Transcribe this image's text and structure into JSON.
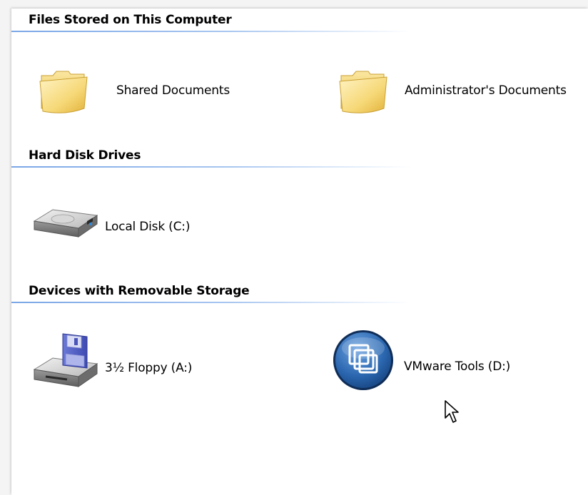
{
  "groups": [
    {
      "header": "Files Stored on This Computer",
      "items": [
        {
          "label": "Shared Documents",
          "icon": "folder-icon"
        },
        {
          "label": "Administrator's Documents",
          "icon": "folder-icon"
        }
      ]
    },
    {
      "header": "Hard Disk Drives",
      "items": [
        {
          "label": "Local Disk (C:)",
          "icon": "hard-drive-icon"
        }
      ]
    },
    {
      "header": "Devices with Removable Storage",
      "items": [
        {
          "label": "3½ Floppy (A:)",
          "icon": "floppy-drive-icon"
        },
        {
          "label": "VMware Tools (D:)",
          "icon": "vmware-cd-icon"
        }
      ]
    }
  ],
  "colors": {
    "header_rule": "#7aa6e6",
    "folder": "#f3d36b",
    "vmware_disc": "#2b67b0"
  }
}
